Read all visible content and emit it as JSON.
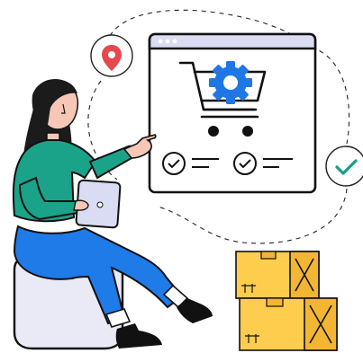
{
  "illustration": {
    "icons": {
      "location": "location-pin-icon",
      "cart": "shopping-cart-icon",
      "gear": "gear-icon",
      "check": "check-icon",
      "boxes": "shipping-box-icon"
    },
    "colors": {
      "outline": "#111111",
      "accent_blue": "#1f77e5",
      "pin_red": "#e5484d",
      "check_teal": "#1a9c8a",
      "shirt_green": "#1aa389",
      "pants_blue": "#1f7be8",
      "box_yellow": "#ffcd4d",
      "box_shade": "#f2b632",
      "seat_lavender": "#eaeaf7",
      "window_bar": "#d9dcf2",
      "skin": "#f6c7b6",
      "hair": "#1b1b1b"
    }
  }
}
